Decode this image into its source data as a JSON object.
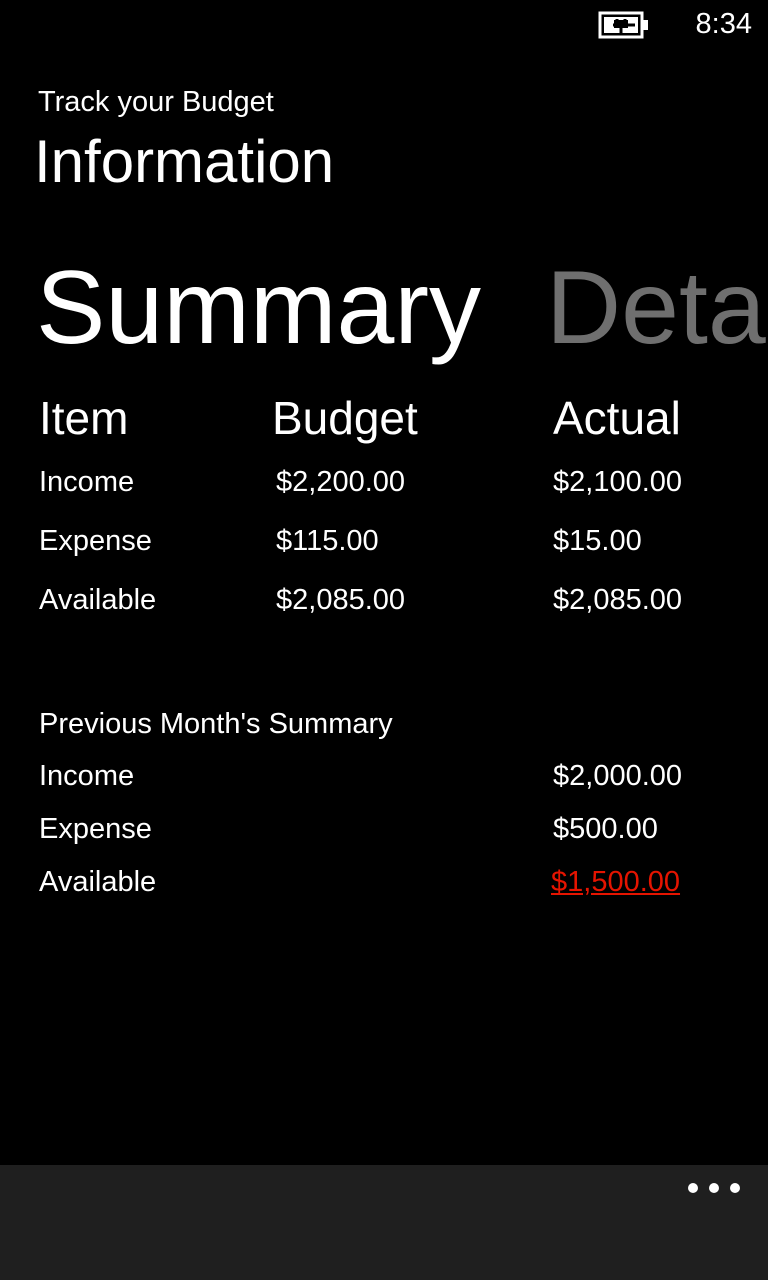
{
  "status_bar": {
    "time": "8:34",
    "battery_icon": "battery-charging-icon"
  },
  "header": {
    "app_title": "Track your Budget",
    "page_title": "Information"
  },
  "pivot": {
    "active": "Summary",
    "next": "Deta"
  },
  "summary": {
    "columns": [
      "Item",
      "Budget",
      "Actual"
    ],
    "rows": [
      {
        "item": "Income",
        "budget": "$2,200.00",
        "actual": "$2,100.00"
      },
      {
        "item": "Expense",
        "budget": "$115.00",
        "actual": "$15.00"
      },
      {
        "item": "Available",
        "budget": "$2,085.00",
        "actual": "$2,085.00"
      }
    ]
  },
  "previous_month": {
    "title": "Previous Month's Summary",
    "rows": [
      {
        "item": "Income",
        "actual": "$2,000.00"
      },
      {
        "item": "Expense",
        "actual": "$500.00"
      },
      {
        "item": "Available",
        "actual": "$1,500.00"
      }
    ]
  },
  "app_bar": {
    "more_icon": "ellipsis-icon"
  },
  "colors": {
    "background": "#000000",
    "text": "#ffffff",
    "inactive_pivot": "#6f6f6f",
    "negative_link": "#e51400",
    "app_bar": "#1f1f1f"
  }
}
